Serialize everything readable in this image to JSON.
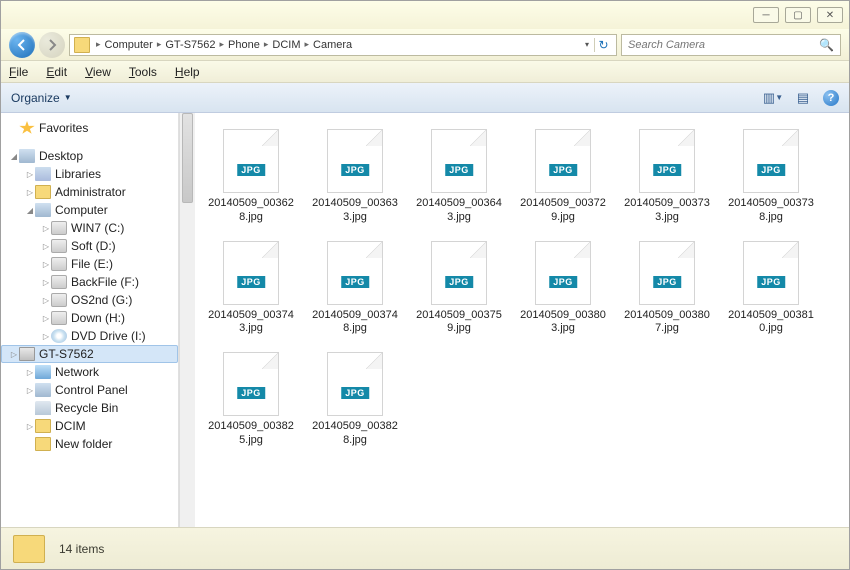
{
  "breadcrumbs": [
    "Computer",
    "GT-S7562",
    "Phone",
    "DCIM",
    "Camera"
  ],
  "search": {
    "placeholder": "Search Camera"
  },
  "menu": {
    "file": "File",
    "edit": "Edit",
    "view": "View",
    "tools": "Tools",
    "help": "Help"
  },
  "toolbar": {
    "organize": "Organize"
  },
  "sidebar": {
    "favorites": "Favorites",
    "desktop": "Desktop",
    "libraries": "Libraries",
    "administrator": "Administrator",
    "computer": "Computer",
    "drives": [
      {
        "label": "WIN7 (C:)"
      },
      {
        "label": "Soft (D:)"
      },
      {
        "label": "File (E:)"
      },
      {
        "label": "BackFile (F:)"
      },
      {
        "label": "OS2nd (G:)"
      },
      {
        "label": "Down (H:)"
      },
      {
        "label": "DVD Drive (I:)"
      },
      {
        "label": "GT-S7562"
      }
    ],
    "network": "Network",
    "controlpanel": "Control Panel",
    "recyclebin": "Recycle Bin",
    "dcim": "DCIM",
    "newfolder": "New folder"
  },
  "files": [
    {
      "name": "20140509_003628.jpg"
    },
    {
      "name": "20140509_003633.jpg"
    },
    {
      "name": "20140509_003643.jpg"
    },
    {
      "name": "20140509_003729.jpg"
    },
    {
      "name": "20140509_003733.jpg"
    },
    {
      "name": "20140509_003738.jpg"
    },
    {
      "name": "20140509_003743.jpg"
    },
    {
      "name": "20140509_003748.jpg"
    },
    {
      "name": "20140509_003759.jpg"
    },
    {
      "name": "20140509_003803.jpg"
    },
    {
      "name": "20140509_003807.jpg"
    },
    {
      "name": "20140509_003810.jpg"
    },
    {
      "name": "20140509_003825.jpg"
    },
    {
      "name": "20140509_003828.jpg"
    }
  ],
  "file_badge": "JPG",
  "status": {
    "count_label": "14 items"
  }
}
